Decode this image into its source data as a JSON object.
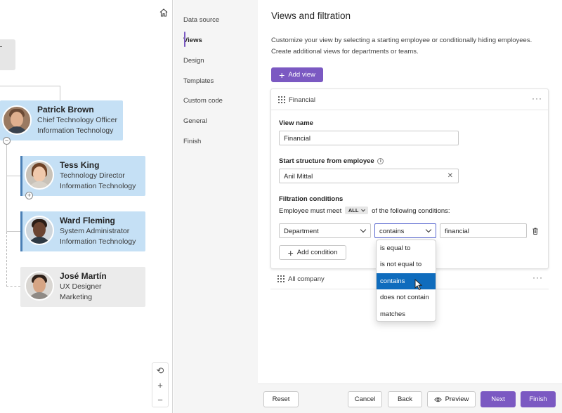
{
  "colors": {
    "accent": "#7b59c2",
    "card_blue": "#c5e0f5",
    "card_grey": "#ebebeb",
    "selected": "#0f6cbd"
  },
  "chart": {
    "people": [
      {
        "name": "Patrick Brown",
        "title": "Chief Technology Officer",
        "department": "Information Technology",
        "toggle": "−"
      },
      {
        "name": "Tess King",
        "title": "Technology Director",
        "department": "Information Technology",
        "toggle": "+"
      },
      {
        "name": "Ward Fleming",
        "title": "System Administrator",
        "department": "Information Technology"
      },
      {
        "name": "José Martín",
        "title": "UX Designer",
        "department": "Marketing"
      }
    ],
    "zoom": {
      "reset": "⟲",
      "in": "+",
      "out": "−"
    }
  },
  "nav": {
    "items": [
      "Data source",
      "Views",
      "Design",
      "Templates",
      "Custom code",
      "General",
      "Finish"
    ],
    "active": "Views"
  },
  "main": {
    "title": "Views and filtration",
    "description": "Customize your view by selecting a starting employee or conditionally hiding employees. Create additional views for departments or teams.",
    "add_view_label": "Add view",
    "views": [
      {
        "title": "Financial",
        "view_name_label": "View name",
        "view_name_value": "Financial",
        "start_label": "Start structure from employee",
        "start_value": "Anil Mittal",
        "filtration_label": "Filtration conditions",
        "must_meet_prefix": "Employee must meet",
        "must_meet_value": "ALL",
        "must_meet_suffix": "of the following conditions:",
        "condition": {
          "field": "Department",
          "operator": "contains",
          "value": "financial"
        },
        "add_condition_label": "Add condition"
      },
      {
        "title": "All company"
      }
    ],
    "operator_options": [
      "is equal to",
      "is not equal to",
      "contains",
      "does not contain",
      "matches"
    ],
    "operator_selected": "contains"
  },
  "footer": {
    "reset": "Reset",
    "cancel": "Cancel",
    "back": "Back",
    "preview": "Preview",
    "next": "Next",
    "finish": "Finish"
  }
}
